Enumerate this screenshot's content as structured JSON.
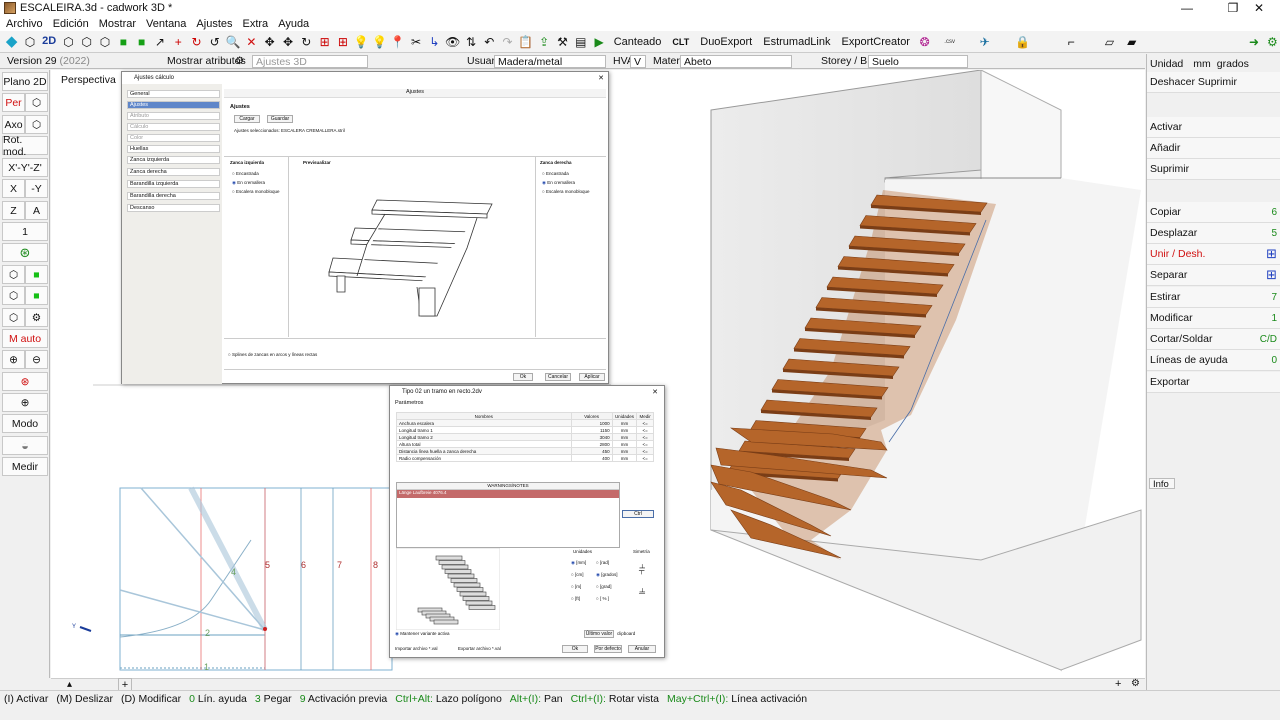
{
  "window": {
    "title": "ESCALEIRA.3d - cadwork 3D *",
    "min": "—",
    "max": "❐",
    "close": "✕"
  },
  "menu": [
    "Archivo",
    "Edición",
    "Mostrar",
    "Ventana",
    "Ajustes",
    "Extra",
    "Ayuda"
  ],
  "toolbar": {
    "view2d": "2D",
    "canteado": "Canteado",
    "clt": "CLT",
    "duoexport": "DuoExport",
    "estrumad": "EstrumadLink",
    "exportcreator": "ExportCreator",
    "csv": ".csv"
  },
  "attrbar": {
    "version": "Version 29",
    "version_year": "(2022)",
    "mostrar": "Mostrar atributos",
    "ajustes3d": "Ajustes 3D",
    "usuario": "Usuario",
    "material_cat": "Madera/metal",
    "hva": "HVA",
    "v": "V",
    "material": "Material",
    "material_val": "Abeto",
    "storey": "Storey / BMT",
    "storey_val": "Suelo"
  },
  "left": {
    "plano2d": "Plano 2D",
    "per": "Per",
    "axo": "Axo",
    "rotmod": "Rot. mod.",
    "xyz": "X'-Y'-Z'",
    "x": "X",
    "y": "-Y",
    "z": "Z",
    "a": "A",
    "one": "1",
    "mauto": "M auto",
    "modo": "Modo",
    "medir": "Medir"
  },
  "viewport": {
    "label": "Perspectiva"
  },
  "right": {
    "unidad": "Unidad",
    "unidad_val": "mm",
    "grados": "grados",
    "items": [
      {
        "label": "Deshacer Suprimir",
        "num": ""
      },
      {
        "label": "Activar",
        "num": ""
      },
      {
        "label": "Añadir",
        "num": ""
      },
      {
        "label": "Suprimir",
        "num": ""
      },
      {
        "label": "Copiar",
        "num": "6"
      },
      {
        "label": "Desplazar",
        "num": "5"
      },
      {
        "label": "Unir / Desh.",
        "num": ""
      },
      {
        "label": "Separar",
        "num": ""
      },
      {
        "label": "Estirar",
        "num": "7"
      },
      {
        "label": "Modificar",
        "num": "1"
      },
      {
        "label": "Cortar/Soldar",
        "num": "C/D"
      },
      {
        "label": "Líneas de ayuda",
        "num": "0"
      },
      {
        "label": "Exportar",
        "num": ""
      }
    ],
    "info": "Info"
  },
  "dialog1": {
    "title": "Ajustes cálculo",
    "header": "Ajustes",
    "nav": [
      "General",
      "Ajustes",
      "Atributo",
      "Cálculo",
      "Color",
      "Huellas",
      "Zanca izquierda",
      "Zanca derecha",
      "Barandilla izquierda",
      "Barandilla derecha",
      "Descanso"
    ],
    "section": "Ajustes",
    "cargar": "Cargar",
    "guardar": "Guardar",
    "selected": "Ajustes seleccionados: ESCALERA CREMALLERA.stril",
    "zanca_izq": "Zanca izquierda",
    "prev": "Previsualizar",
    "zanca_der": "Zanca derecha",
    "opts": [
      "Encastrada",
      "En cremallera",
      "Escalera monobloque"
    ],
    "check": "Splines de zancas en arcos y líneas rectas",
    "ok": "Ok",
    "cancel": "Cancelar",
    "apply": "Aplicar"
  },
  "dialog2": {
    "title": "Tipo 02 un tramo en recto.2dv",
    "params": "Parámetros",
    "cols": [
      "Nombres",
      "Valores",
      "Unidades",
      "Medir"
    ],
    "rows": [
      {
        "name": "Anchura escalera",
        "value": "1000",
        "unit": "mm",
        "m": "<="
      },
      {
        "name": "Longitud tramo 1",
        "value": "1150",
        "unit": "mm",
        "m": "<="
      },
      {
        "name": "Longitud tramo 2",
        "value": "3040",
        "unit": "mm",
        "m": "<="
      },
      {
        "name": "Altura total",
        "value": "2800",
        "unit": "mm",
        "m": "<="
      },
      {
        "name": "Distancia línea huella a zanca derecha",
        "value": "450",
        "unit": "mm",
        "m": "<="
      },
      {
        "name": "Radio compensación",
        "value": "400",
        "unit": "mm",
        "m": "<="
      }
    ],
    "warnings": "WARNINGS/NOTES",
    "warn_line": "Länge Laufbreie 4076.4",
    "ctrl": "Ctrl",
    "units": "Unidades",
    "symmetry": "Simetría",
    "unit_opts": [
      "[mm]",
      "[cm]",
      "[m]",
      "[ft]",
      "[rad]",
      "[grados]",
      "[grad]",
      "[ % ]"
    ],
    "keep": "Mantener variante activa",
    "last": "Último valor",
    "clipboard": "clipboard",
    "import": "Importar archivo *.val",
    "export": "Exportar archivo *.val",
    "ok": "Ok",
    "default": "Por defecto",
    "cancel": "Anular"
  },
  "plan": {
    "labels": [
      "1",
      "2",
      "4",
      "5",
      "6",
      "7",
      "8"
    ],
    "ylabel": "Y"
  },
  "status": {
    "items": [
      {
        "k": "(I)",
        "v": "Activar"
      },
      {
        "k": "(M)",
        "v": "Deslizar"
      },
      {
        "k": "(D)",
        "v": "Modificar"
      },
      {
        "k": "0",
        "v": "Lín. ayuda"
      },
      {
        "k": "3",
        "v": "Pegar"
      },
      {
        "k": "9",
        "v": "Activación previa"
      },
      {
        "k": "Ctrl+Alt:",
        "v": "Lazo polígono"
      },
      {
        "k": "Alt+(I):",
        "v": "Pan"
      },
      {
        "k": "Ctrl+(I):",
        "v": "Rotar vista"
      },
      {
        "k": "May+Ctrl+(I):",
        "v": "Línea activación"
      }
    ]
  },
  "colors": {
    "wood": "#b5652a",
    "wood_dark": "#7a3d16",
    "warning": "#c46a6a",
    "accent_green": "#1a8a1a",
    "accent_red": "#d01010"
  }
}
